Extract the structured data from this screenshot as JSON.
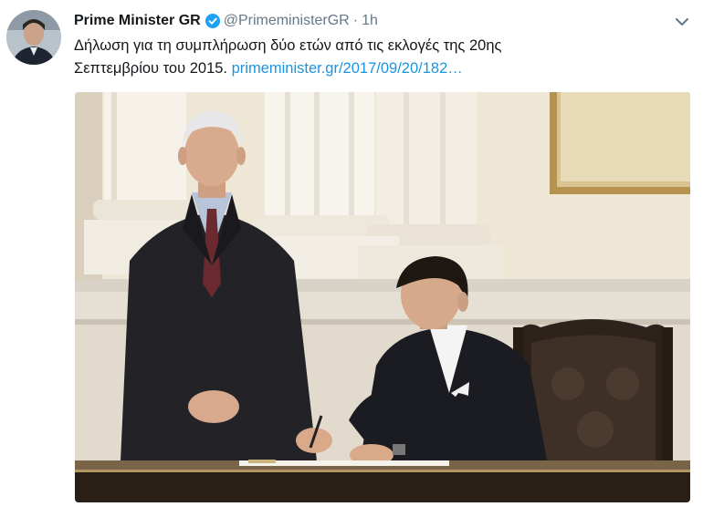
{
  "tweet": {
    "author_name": "Prime Minister GR",
    "handle": "@PrimeministerGR",
    "separator": "·",
    "timestamp": "1h",
    "text_line1": "Δήλωση για τη συμπλήρωση δύο ετών από τις εκλογές της 20ης",
    "text_line2": "Σεπτεμβρίου του 2015.",
    "link": "primeminister.gr/2017/09/20/182…"
  },
  "icons": {
    "verified": "verified-badge-icon",
    "caret": "chevron-down-icon"
  },
  "colors": {
    "link": "#1b95e0",
    "verified": "#1da1f2",
    "secondary_text": "#657786"
  }
}
